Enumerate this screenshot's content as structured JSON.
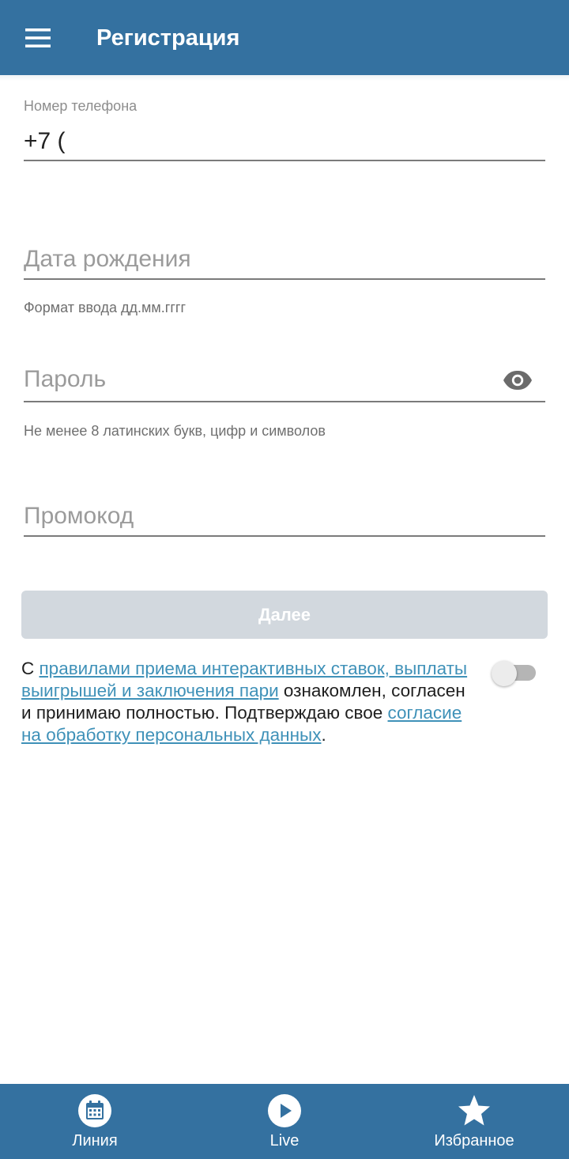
{
  "header": {
    "title": "Регистрация",
    "menu_icon": "menu-icon"
  },
  "form": {
    "phone": {
      "label": "Номер телефона",
      "value": "+7 ("
    },
    "birthdate": {
      "placeholder": "Дата рождения",
      "hint": "Формат ввода дд.мм.гггг"
    },
    "password": {
      "placeholder": "Пароль",
      "hint": "Не менее 8 латинских букв, цифр и символов",
      "toggle_icon": "eye-icon"
    },
    "promo": {
      "placeholder": "Промокод"
    },
    "next_label": "Далее"
  },
  "agreement": {
    "prefix": "С ",
    "rules_link": "правилами приема интерактивных ставок, выплаты выигрышей и заключения пари",
    "middle": " ознакомлен, согласен и принимаю полностью. Подтверждаю свое ",
    "consent_link": "согласие на обработку персональных данных",
    "suffix": ".",
    "switch_on": false
  },
  "bottom_nav": {
    "items": [
      {
        "label": "Линия",
        "icon": "calendar-icon"
      },
      {
        "label": "Live",
        "icon": "play-icon"
      },
      {
        "label": "Избранное",
        "icon": "star-icon"
      }
    ]
  },
  "colors": {
    "brand": "#3471a0",
    "link": "#3f91b8",
    "button_disabled": "#d2d8de"
  }
}
